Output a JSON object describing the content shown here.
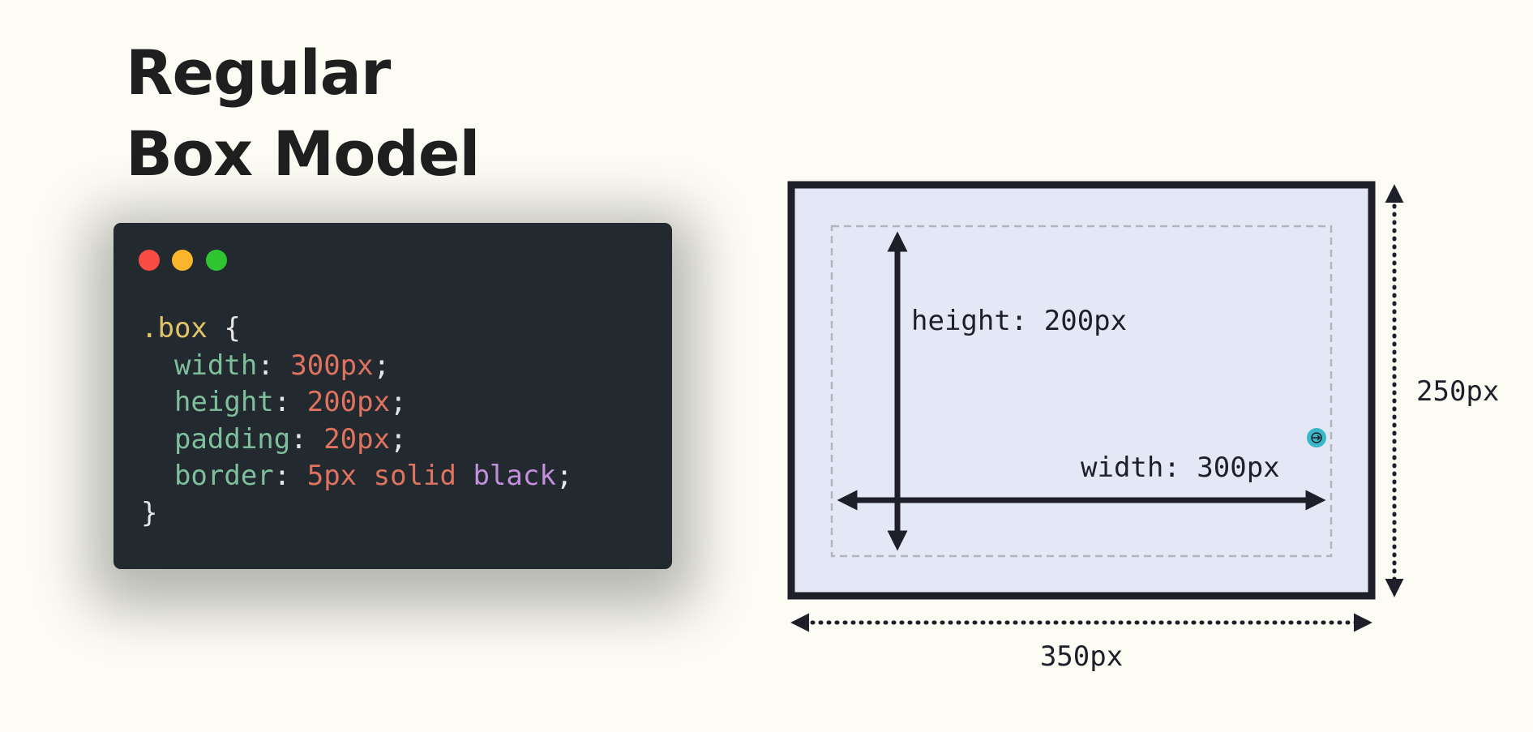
{
  "title": {
    "line1": "Regular",
    "line2": "Box Model"
  },
  "code": {
    "selector": ".box",
    "open_brace": "{",
    "close_brace": "}",
    "declarations": [
      {
        "property": "width",
        "value": "300px"
      },
      {
        "property": "height",
        "value": "200px"
      },
      {
        "property": "padding",
        "value": "20px"
      },
      {
        "property": "border",
        "value": "5px solid",
        "keyword": "black"
      }
    ]
  },
  "diagram": {
    "height_label": "height: 200px",
    "width_label": "width: 300px",
    "outer_height_label": "250px",
    "outer_width_label": "350px"
  },
  "colors": {
    "background": "#fcfcf4",
    "code_background": "#222a30",
    "box_fill": "#e4e7f5",
    "box_border": "#1f1f2a",
    "cursor": "#3ab8c8"
  }
}
